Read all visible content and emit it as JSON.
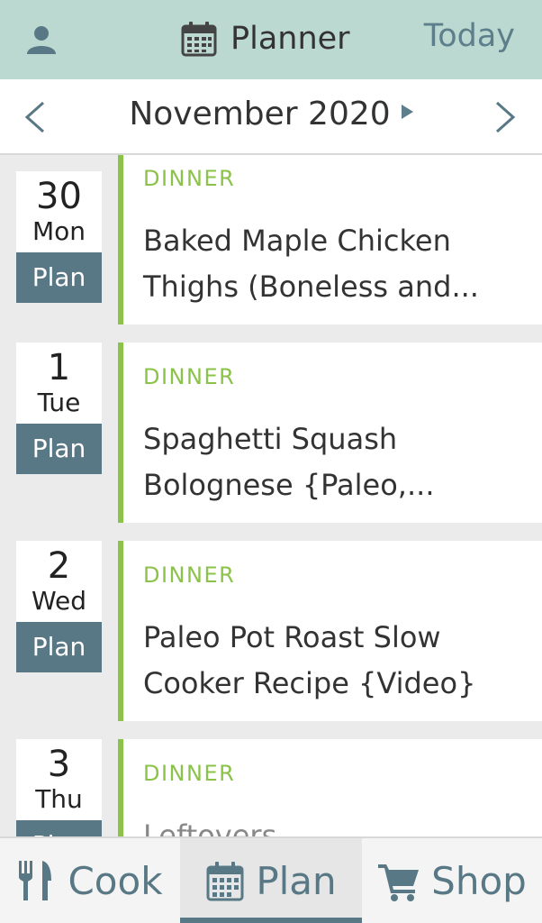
{
  "header": {
    "title": "Planner",
    "today": "Today"
  },
  "month": {
    "label": "November 2020"
  },
  "days": [
    {
      "num": "30",
      "dow": "Mon",
      "plan": "Plan",
      "meal": "DINNER",
      "recipe": "Baked Maple Chicken Thighs (Boneless and..."
    },
    {
      "num": "1",
      "dow": "Tue",
      "plan": "Plan",
      "meal": "DINNER",
      "recipe": "Spaghetti Squash Bolognese {Paleo,..."
    },
    {
      "num": "2",
      "dow": "Wed",
      "plan": "Plan",
      "meal": "DINNER",
      "recipe": "Paleo Pot Roast Slow Cooker Recipe {Video}"
    },
    {
      "num": "3",
      "dow": "Thu",
      "plan": "Plan",
      "meal": "DINNER",
      "recipe": "Leftovers"
    }
  ],
  "tabs": {
    "cook": "Cook",
    "plan": "Plan",
    "shop": "Shop"
  },
  "colors": {
    "header_bg": "#bcd9d1",
    "accent": "#587885",
    "meal_green": "#8bc34a"
  }
}
